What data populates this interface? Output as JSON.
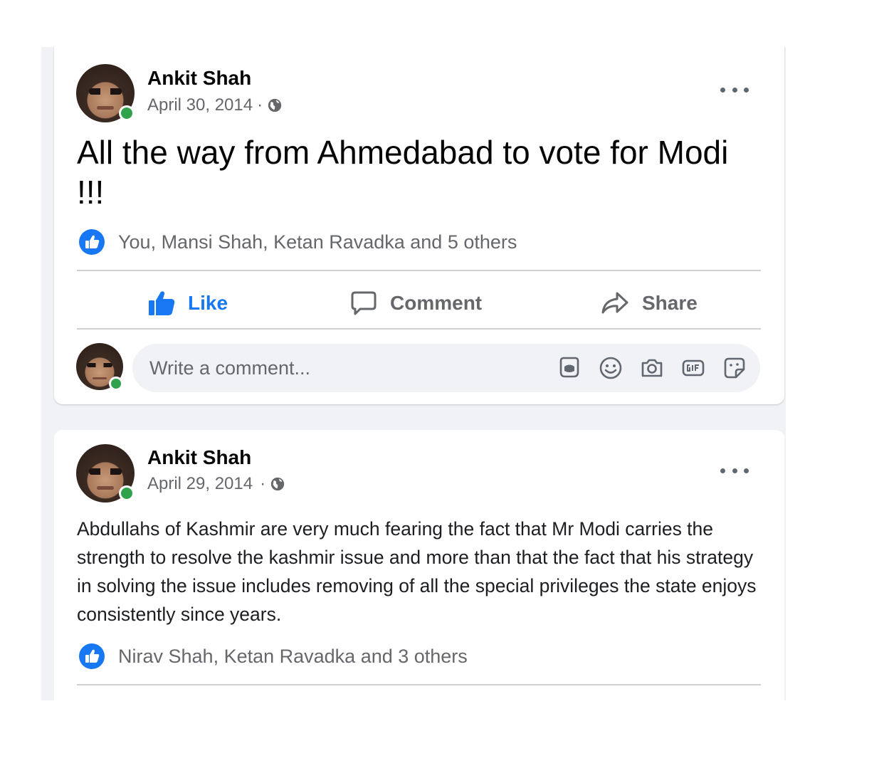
{
  "posts": [
    {
      "author": "Ankit Shah",
      "date": "April 30, 2014",
      "separator": "·",
      "text": "All the way from Ahmedabad to vote for Modi !!!",
      "reactions": "You, Mansi Shah, Ketan Ravadka and 5 others",
      "actions": {
        "like": "Like",
        "comment": "Comment",
        "share": "Share"
      },
      "comment_placeholder": "Write a comment...",
      "comment_icons": [
        "avatar-sticker-icon",
        "emoji-icon",
        "camera-icon",
        "gif-icon",
        "sticker-icon"
      ]
    },
    {
      "author": "Ankit Shah",
      "date": "April 29, 2014",
      "separator": "·",
      "text": "Abdullahs of Kashmir are very much fearing the fact that Mr Modi carries the strength to resolve the kashmir issue and more than that the fact that his strategy in solving the issue includes removing of all the special privileges the state enjoys consistently since years.",
      "reactions": "Nirav Shah, Ketan Ravadka and 3 others"
    }
  ],
  "colors": {
    "accent": "#1877f2",
    "online": "#31a24c",
    "secondary_text": "#65676b",
    "feed_background": "#f0f2f5"
  }
}
